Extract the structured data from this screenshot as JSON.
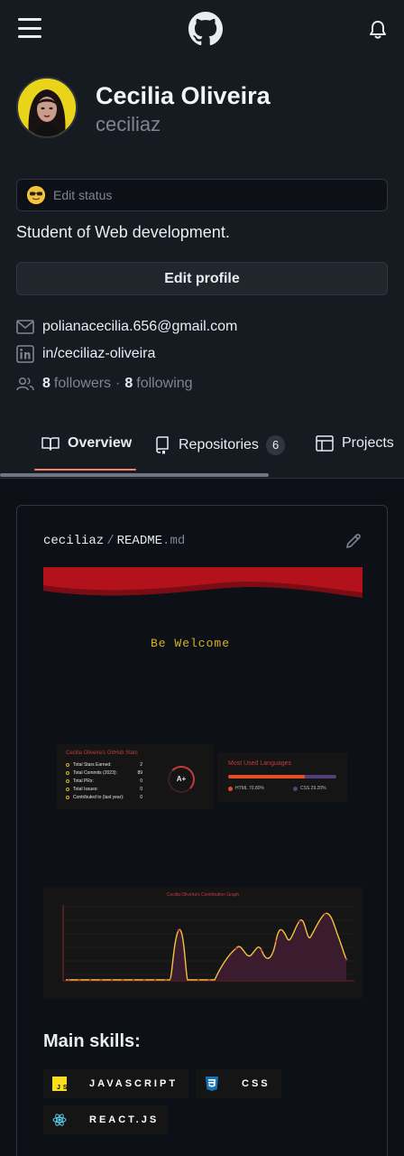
{
  "icons": {
    "menu": "hamburger-icon",
    "logo": "github-logo-icon",
    "notifications": "bell-icon",
    "email": "mail-icon",
    "linkedin": "linkedin-icon",
    "people": "people-icon",
    "overview": "book-icon",
    "repositories": "repo-icon",
    "projects": "table-icon",
    "edit": "pencil-icon"
  },
  "profile": {
    "name": "Cecilia Oliveira",
    "login": "ceciliaz",
    "status_label": "Edit status",
    "bio": "Student of Web development.",
    "edit_profile_label": "Edit profile",
    "email": "polianacecilia.656@gmail.com",
    "linkedin": "in/ceciliaz-oliveira",
    "followers_count": "8",
    "followers_label": "followers",
    "separator": "·",
    "following_count": "8",
    "following_label": "following"
  },
  "tabs": [
    {
      "label": "Overview",
      "selected": true
    },
    {
      "label": "Repositories",
      "count": "6"
    },
    {
      "label": "Projects"
    }
  ],
  "readme": {
    "owner": "ceciliaz",
    "separator": "/",
    "file": "README",
    "ext": ".md",
    "welcome": "Be Welcome",
    "stats_card": {
      "title": "Cecilia Oliveira's GitHub Stats",
      "rows": [
        {
          "label": "Total Stars Earned:",
          "value": "2"
        },
        {
          "label": "Total Commits (2023):",
          "value": "89"
        },
        {
          "label": "Total PRs:",
          "value": "0"
        },
        {
          "label": "Total Issues:",
          "value": "0"
        },
        {
          "label": "Contributed to (last year):",
          "value": "0"
        }
      ],
      "grade": "A+"
    },
    "languages_card": {
      "title": "Most Used Languages",
      "langs": [
        {
          "name": "HTML",
          "pct_label": "70.80%",
          "pct": 70.8,
          "color": "#e34c26"
        },
        {
          "name": "CSS",
          "pct_label": "29.20%",
          "pct": 29.2,
          "color": "#563d7c"
        }
      ]
    },
    "graph_title": "Cecilia Oliveira's Contribution Graph",
    "skills_title": "Main skills:",
    "skills": [
      "JAVASCRIPT",
      "CSS",
      "REACT.JS"
    ]
  },
  "colors": {
    "accent": "#f78166",
    "bg": "#0d1117",
    "surface": "#161b22",
    "border": "#30363d",
    "muted": "#7d8590",
    "banner": "#b3121d",
    "welcome": "#d8b31c",
    "graph_line": "#f2c33c",
    "graph_fill": "#3a1c2e"
  }
}
